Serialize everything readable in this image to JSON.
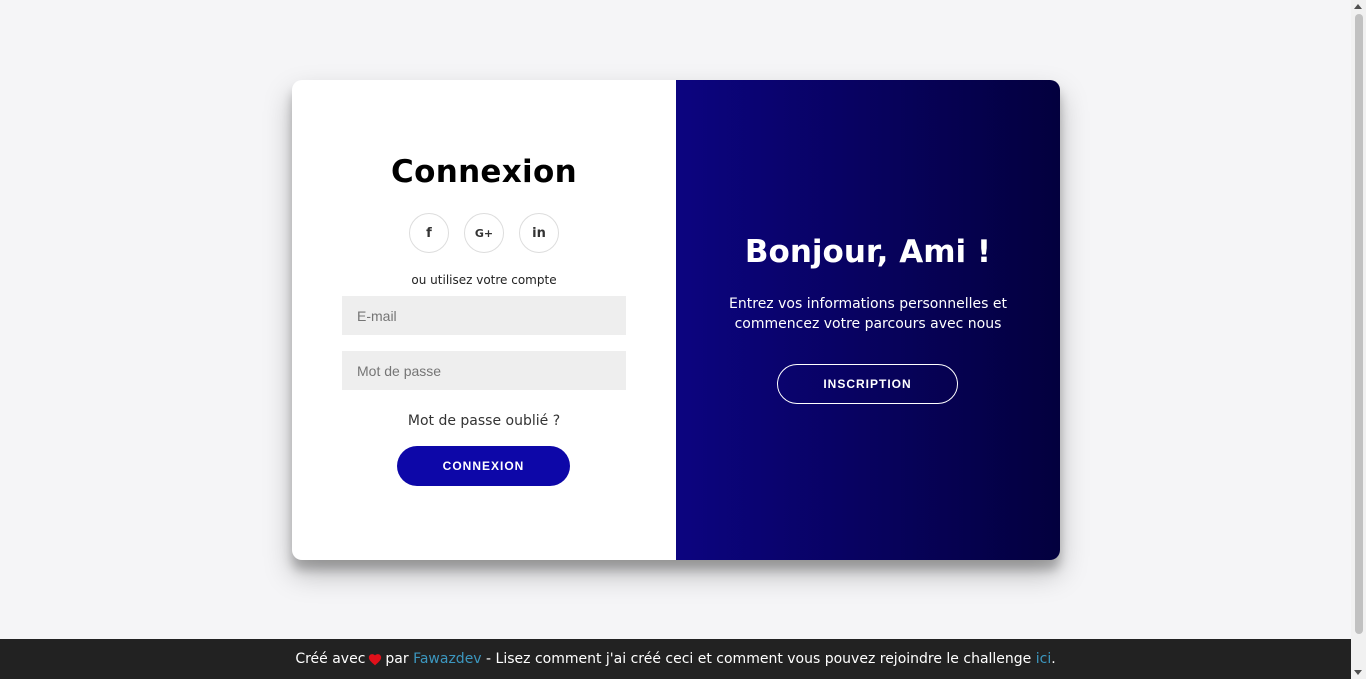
{
  "login": {
    "title": "Connexion",
    "socials": [
      {
        "icon": "facebook-icon",
        "glyph": "f"
      },
      {
        "icon": "google-plus-icon",
        "glyph": "G+"
      },
      {
        "icon": "linkedin-icon",
        "glyph": "in"
      }
    ],
    "subtitle": "ou utilisez votre compte",
    "email_placeholder": "E-mail",
    "password_placeholder": "Mot de passe",
    "forgot_label": "Mot de passe oublié ?",
    "submit_label": "CONNEXION"
  },
  "overlay": {
    "title": "Bonjour, Ami !",
    "text": "Entrez vos informations personnelles et commencez votre parcours avec nous",
    "button_label": "INSCRIPTION"
  },
  "footer": {
    "made_with": "Créé avec",
    "by": "par",
    "author": "Fawazdev",
    "middle": "- Lisez comment j'ai créé ceci et comment vous pouvez rejoindre le challenge",
    "link": "ici",
    "end": "."
  },
  "colors": {
    "primary_button": "#0d07a8",
    "overlay_gradient_start": "#0c0480",
    "overlay_gradient_end": "#03003e",
    "footer_bg": "#222222",
    "link": "#3c97bf",
    "heart": "#e0101a"
  }
}
